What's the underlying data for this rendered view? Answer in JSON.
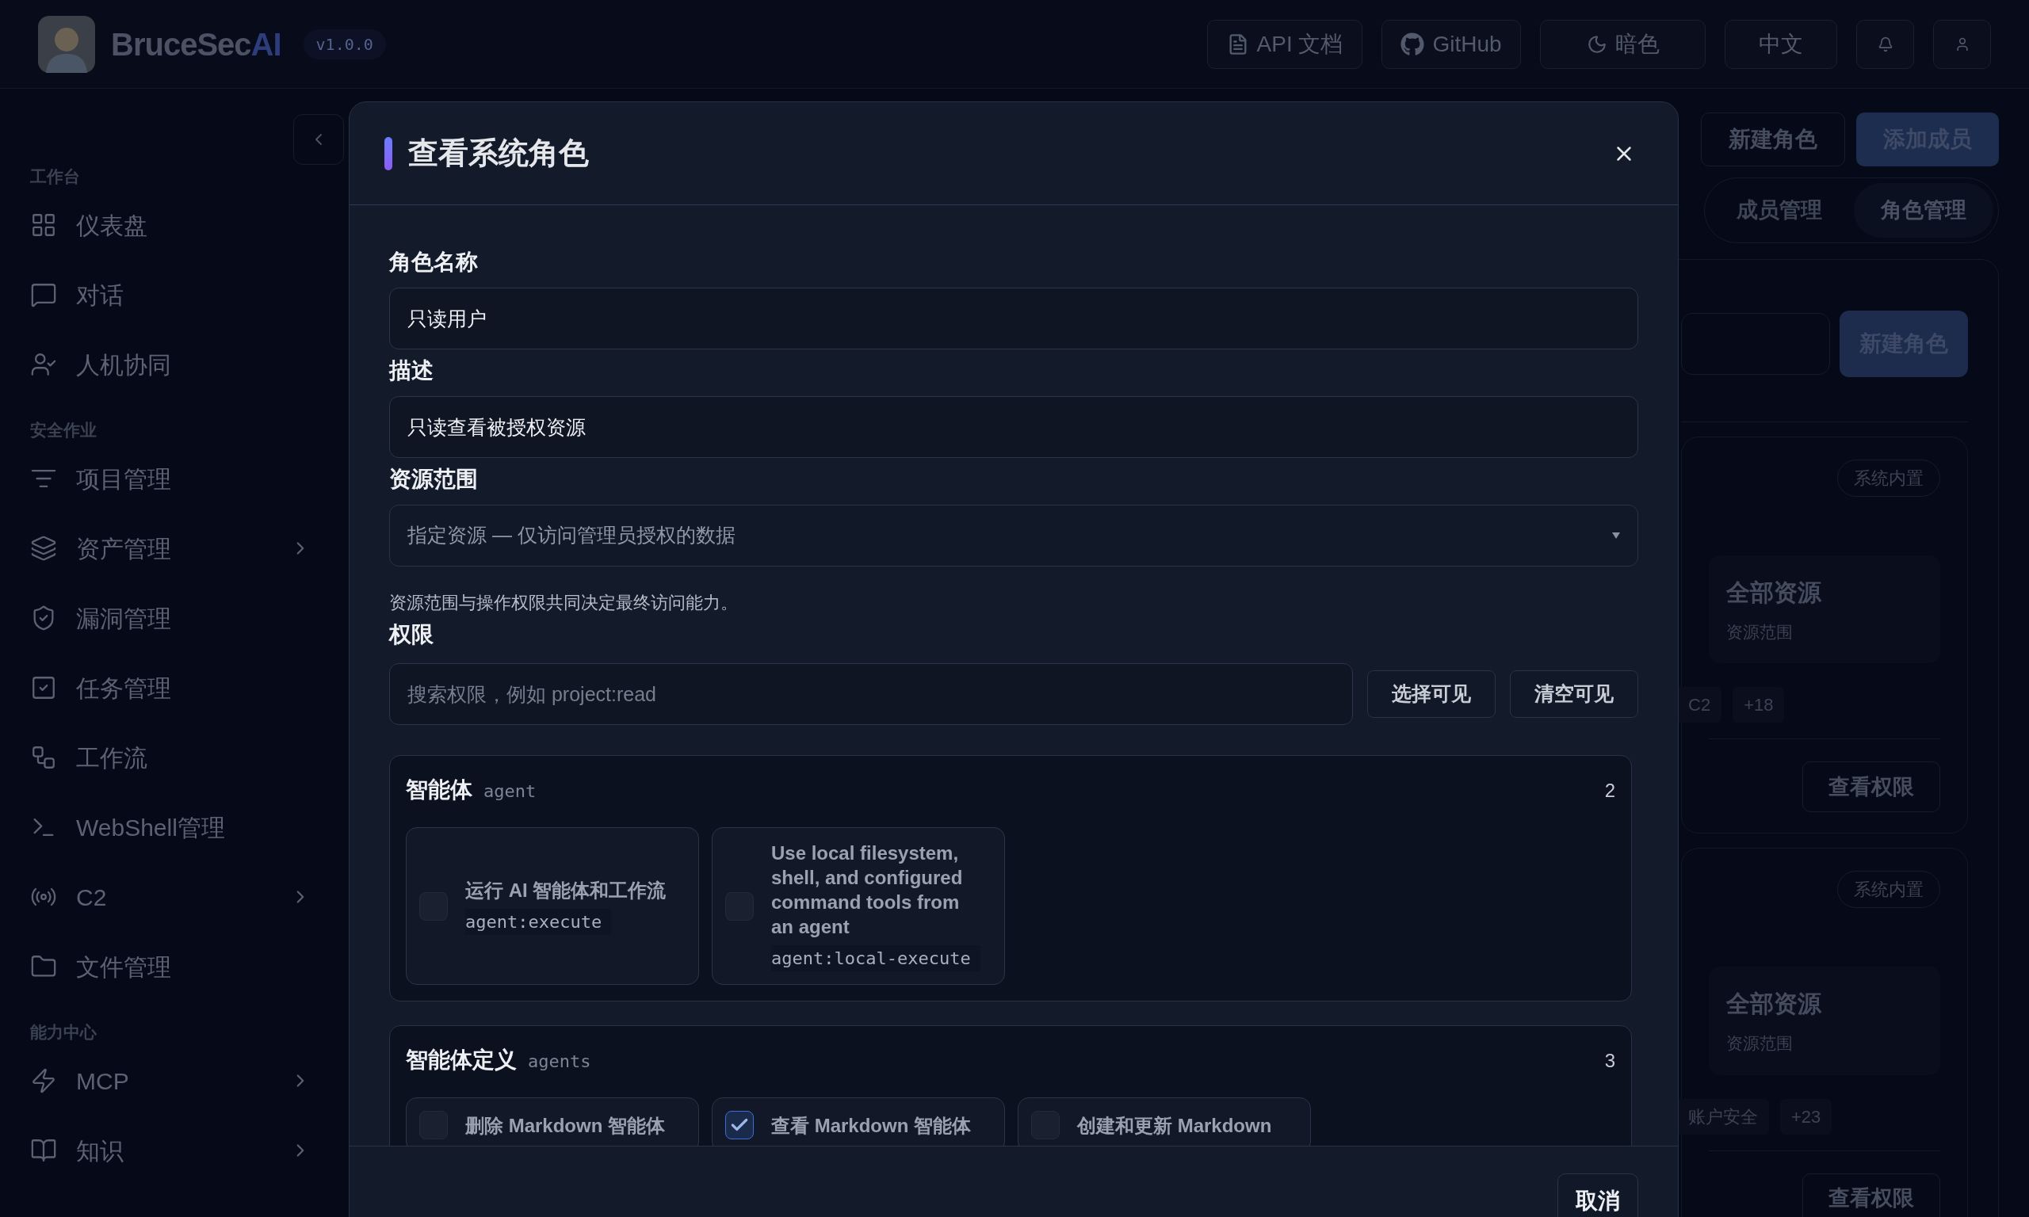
{
  "header": {
    "logo_text": "BruceSec",
    "logo_accent": "AI",
    "version": "v1.0.0",
    "buttons": [
      {
        "kind": "doc",
        "label": "API 文档"
      },
      {
        "kind": "github",
        "label": "GitHub"
      },
      {
        "kind": "moon",
        "label": "暗色"
      },
      {
        "kind": "text",
        "label": "中文"
      },
      {
        "kind": "bell"
      },
      {
        "kind": "user"
      }
    ]
  },
  "sidebar": {
    "groups": [
      {
        "title": "工作台",
        "items": [
          {
            "label": "仪表盘",
            "expandable": false
          },
          {
            "label": "对话",
            "expandable": false
          },
          {
            "label": "人机协同",
            "expandable": false
          }
        ]
      },
      {
        "title": "安全作业",
        "items": [
          {
            "label": "项目管理",
            "expandable": false
          },
          {
            "label": "资产管理",
            "expandable": true
          },
          {
            "label": "漏洞管理",
            "expandable": false
          },
          {
            "label": "任务管理",
            "expandable": false
          },
          {
            "label": "工作流",
            "expandable": false
          },
          {
            "label": "WebShell管理",
            "expandable": false
          },
          {
            "label": "C2",
            "expandable": true
          },
          {
            "label": "文件管理",
            "expandable": false
          }
        ]
      },
      {
        "title": "能力中心",
        "items": [
          {
            "label": "MCP",
            "expandable": true
          },
          {
            "label": "知识",
            "expandable": true
          }
        ]
      }
    ]
  },
  "page": {
    "actions": [
      {
        "label": "新建角色",
        "kind": "outline"
      },
      {
        "label": "添加成员",
        "kind": "primary"
      }
    ],
    "tabs": [
      {
        "label": "成员管理",
        "selected": false
      },
      {
        "label": "角色管理",
        "selected": true
      }
    ],
    "create_button": "新建角色",
    "roles": [
      {
        "badge": "系统内置",
        "scope_value": "全部资源",
        "scope_label": "资源范围",
        "chips": [
          "C2",
          "+18"
        ],
        "button": "查看权限"
      },
      {
        "badge": "系统内置",
        "scope_value": "全部资源",
        "scope_label": "资源范围",
        "chips": [
          "账户安全",
          "+23"
        ],
        "button": "查看权限"
      }
    ]
  },
  "dialog": {
    "title": "查看系统角色",
    "fields": [
      {
        "label": "角色名称",
        "value": "只读用户",
        "kind": "input"
      },
      {
        "label": "描述",
        "value": "只读查看被授权资源",
        "kind": "input"
      },
      {
        "label": "资源范围",
        "value": "指定资源 — 仅访问管理员授权的数据",
        "kind": "select"
      }
    ],
    "hint": "资源范围与操作权限共同决定最终访问能力。",
    "permissions_label": "权限",
    "search_placeholder": "搜索权限，例如 project:read",
    "search_buttons": [
      "选择可见",
      "清空可见"
    ],
    "groups": [
      {
        "title": "智能体",
        "key": "agent",
        "count": "2",
        "items": [
          {
            "label": "运行 AI 智能体和工作流",
            "code": "agent:execute",
            "checked": false
          },
          {
            "label": "Use local filesystem, shell, and configured command tools from an agent",
            "code": "agent:local-execute",
            "checked": false
          }
        ]
      },
      {
        "title": "智能体定义",
        "key": "agents",
        "count": "3",
        "items": [
          {
            "label": "删除 Markdown 智能体",
            "checked": false
          },
          {
            "label": "查看 Markdown 智能体",
            "checked": true
          },
          {
            "label": "创建和更新 Markdown",
            "checked": false
          }
        ]
      }
    ],
    "footer_buttons": [
      "取消"
    ]
  }
}
